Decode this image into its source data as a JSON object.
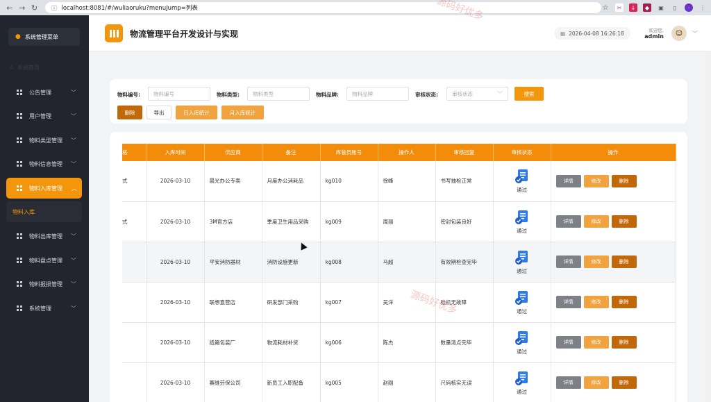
{
  "browser": {
    "url": "localhost:8081/#/wuliaoruku?menuJump=列表"
  },
  "sidebar": {
    "header": "系统管理菜单",
    "faint_item": "系统首页",
    "items": [
      {
        "label": "公告管理"
      },
      {
        "label": "用户管理"
      },
      {
        "label": "物料类型管理"
      },
      {
        "label": "物料信息管理"
      },
      {
        "label": "物料入库管理"
      },
      {
        "label": "物料出库管理"
      },
      {
        "label": "物料盘点管理"
      },
      {
        "label": "物料报损管理"
      },
      {
        "label": "系统管理"
      }
    ],
    "active_sub": "物料入库"
  },
  "header": {
    "title": "物流管理平台开发设计与实现",
    "datetime": "2026-04-08 16:26:18",
    "welcome": "欢迎您,",
    "username": "admin"
  },
  "filters": {
    "code_label": "物料编号:",
    "code_placeholder": "物料编号",
    "type_label": "物料类型:",
    "type_placeholder": "物料类型",
    "brand_label": "物料品牌:",
    "brand_placeholder": "物料品牌",
    "status_label": "审核状态:",
    "status_placeholder": "审核状态",
    "search_btn": "搜索",
    "delete_btn": "删除",
    "export_btn": "导出",
    "daily_btn": "日入库统计",
    "monthly_btn": "月入库统计"
  },
  "table": {
    "columns": [
      "格",
      "入库时间",
      "供应商",
      "备注",
      "库管员账号",
      "操作人",
      "审核回复",
      "审核状态",
      "操作"
    ],
    "action_detail": "详情",
    "action_edit": "修改",
    "action_delete": "删除",
    "rows": [
      {
        "c0": "式",
        "time": "2026-03-10",
        "supplier": "晨光办公专卖",
        "note": "月度办公消耗品",
        "account": "kg010",
        "operator": "徐峰",
        "reply": "书写抽检正常",
        "status": "通过"
      },
      {
        "c0": "式",
        "time": "2026-03-10",
        "supplier": "3M官方店",
        "note": "季度卫生用品采购",
        "account": "kg009",
        "operator": "周丽",
        "reply": "密封包装良好",
        "status": "通过"
      },
      {
        "c0": "",
        "time": "2026-03-10",
        "supplier": "平安消防器材",
        "note": "消防设施更新",
        "account": "kg008",
        "operator": "马超",
        "reply": "有效期检查完毕",
        "status": "通过"
      },
      {
        "c0": "",
        "time": "2026-03-10",
        "supplier": "联想直营店",
        "note": "研发部门采购",
        "account": "kg007",
        "operator": "吴洋",
        "reply": "验机无故障",
        "status": "通过"
      },
      {
        "c0": "",
        "time": "2026-03-10",
        "supplier": "纸箱包装厂",
        "note": "物流耗材补货",
        "account": "kg006",
        "operator": "陈杰",
        "reply": "数量清点完毕",
        "status": "通过"
      },
      {
        "c0": "",
        "time": "2026-03-10",
        "supplier": "赛维劳保公司",
        "note": "新员工入职配备",
        "account": "kg005",
        "operator": "赵刚",
        "reply": "尺码核实无误",
        "status": "通过"
      }
    ]
  },
  "watermark": "源码好优多",
  "colors": {
    "accent": "#f3960b",
    "sidebar": "#22252d",
    "danger": "#c1680a"
  }
}
